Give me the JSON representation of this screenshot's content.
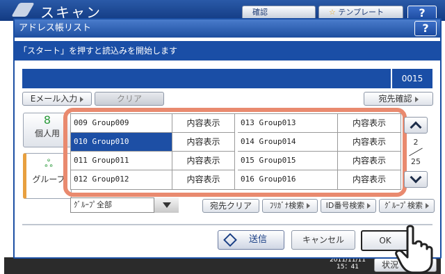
{
  "background": {
    "title": "スキャン",
    "confirm_label": "確認",
    "template_label": "テンプレート",
    "help_label": "?",
    "date": "2011/11/11",
    "time": "15：41",
    "status_label": "状況"
  },
  "dialog": {
    "title": "アドレス帳リスト",
    "help_label": "?",
    "message": "「スタート」を押すと読込みを開始します",
    "count": "0015"
  },
  "toolbar": {
    "email_input_label": "Eメール入力",
    "clear_label": "クリア",
    "dest_confirm_label": "宛先確認"
  },
  "tabs": [
    {
      "label": "個人用",
      "icon": "person-icon"
    },
    {
      "label": "グループ",
      "icon": "group-icon"
    }
  ],
  "groups_left": [
    {
      "number": "009",
      "name": "Group009",
      "view": "内容表示",
      "selected": false
    },
    {
      "number": "010",
      "name": "Group010",
      "view": "内容表示",
      "selected": true
    },
    {
      "number": "011",
      "name": "Group011",
      "view": "内容表示",
      "selected": false
    },
    {
      "number": "012",
      "name": "Group012",
      "view": "内容表示",
      "selected": false
    }
  ],
  "groups_right": [
    {
      "number": "013",
      "name": "Group013",
      "view": "内容表示"
    },
    {
      "number": "014",
      "name": "Group014",
      "view": "内容表示"
    },
    {
      "number": "015",
      "name": "Group015",
      "view": "内容表示"
    },
    {
      "number": "016",
      "name": "Group016",
      "view": "内容表示"
    }
  ],
  "pager": {
    "current": "2",
    "total": "25"
  },
  "filter": {
    "group_select_value": "ｸﾞﾙｰﾌﾟ全部",
    "dest_clear_label": "宛先クリア",
    "furigana_search_label": "ﾌﾘｶﾞﾅ検索",
    "id_search_label": "ID番号検索",
    "group_search_label": "ｸﾞﾙｰﾌﾟ検索"
  },
  "actions": {
    "send_label": "送信",
    "cancel_label": "キャンセル",
    "ok_label": "OK"
  },
  "colors": {
    "primary_blue": "#1a4ea6",
    "highlight": "#e98a6f",
    "tab_accent": "#e8a040"
  }
}
